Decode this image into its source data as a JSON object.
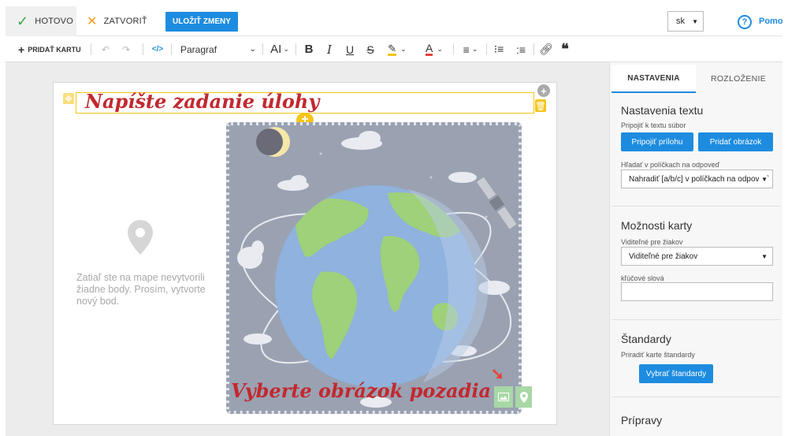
{
  "header": {
    "done_label": "HOTOVO",
    "close_label": "ZATVORIŤ",
    "save_label": "ULOŽIŤ ZMENY",
    "language_value": "sk",
    "help_label": "Pomoc"
  },
  "toolbar": {
    "add_card_label": "PRIDAŤ KARTU",
    "paragraph_label": "Paragraf",
    "font_size_label": "AI"
  },
  "card": {
    "title_text": "Napíšte zadanie úlohy",
    "empty_message": "Zatiaľ ste na mape nevytvorili žiadne body. Prosím, vytvorte nový bod.",
    "background_caption": "Vyberte obrázok pozadia"
  },
  "panel": {
    "tabs": [
      "NASTAVENIA",
      "ROZLOŽENIE"
    ],
    "text_settings": {
      "title": "Nastavenia textu",
      "attach_label": "Pripojiť k textu súbor",
      "attach_button": "Pripojiť prílohu",
      "image_button": "Pridať obrázok",
      "search_label": "Hľadať v políčkach na odpoveď",
      "search_value": "Nahradiť [a/b/c] v políčkach na odpoveď"
    },
    "card_options": {
      "title": "Možnosti karty",
      "visible_label": "Viditeľné pre žiakov",
      "visible_value": "Viditeľné pre žiakov",
      "keywords_label": "kľúčové slová",
      "keywords_value": ""
    },
    "standards": {
      "title": "Štandardy",
      "assign_label": "Priradiť karte štandardy",
      "select_button": "Vybrať štandardy"
    },
    "preparations": {
      "title": "Prípravy"
    }
  },
  "colors": {
    "accent": "#1d8ce0",
    "done_check": "#3aa84a",
    "close_x": "#f29b1d",
    "handle_yellow": "#f5c518",
    "annotation_red": "#c2282f",
    "icon_green": "#a8d8a6"
  }
}
